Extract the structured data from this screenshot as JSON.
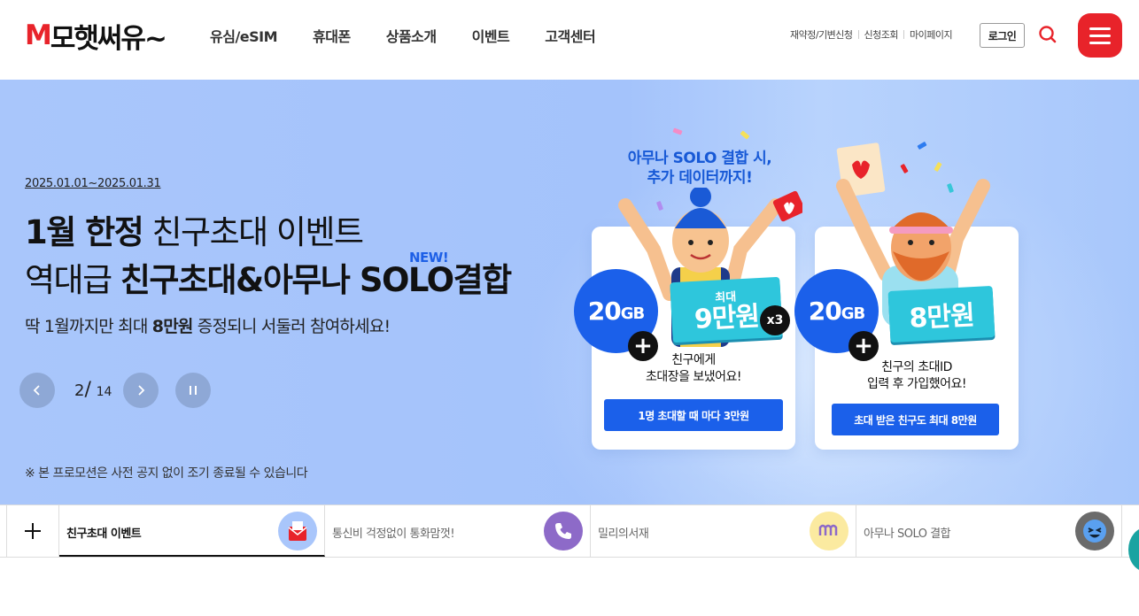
{
  "header": {
    "logo_m": "M",
    "logo_rest": "모햇써유~",
    "nav": [
      "유심/eSIM",
      "휴대폰",
      "상품소개",
      "이벤트",
      "고객센터"
    ],
    "util_links": [
      "재약정/기변신청",
      "신청조회",
      "마이페이지"
    ],
    "login_label": "로그인"
  },
  "hero": {
    "period": "2025.01.01~2025.01.31",
    "title_line1_bold": "1월 한정",
    "title_line1_rest": " 친구초대 이벤트",
    "title_line2_pre": "역대급 ",
    "title_line2_bold": "친구초대&아무나 SOLO결합",
    "new_badge": "NEW!",
    "sub_pre": "딱 1월까지만 최대 ",
    "sub_bold": "8만원",
    "sub_post": " 증정되니 서둘러 참여하세요!",
    "page_current": "2",
    "page_sep": "/",
    "page_total": "14",
    "notice": "※ 본 프로모션은 사전 공지 없이 조기 종료될 수 있습니다"
  },
  "promo": {
    "head_line1": "아무나 SOLO 결합 시,",
    "head_line2": "추가 데이터까지!",
    "left": {
      "gb_num": "20",
      "gb_unit": "GB",
      "ticket_small": "최대",
      "ticket_big": "9만원",
      "text_line1": "친구에게",
      "text_line2": "초대장을 보냈어요!",
      "button": "1명 초대할 때 마다 3만원",
      "multiplier": "x3"
    },
    "right": {
      "gb_num": "20",
      "gb_unit": "GB",
      "ticket_big": "8만원",
      "text_line1": "친구의 초대ID",
      "text_line2": "입력 후 가입했어요!",
      "button": "초대 받은 친구도 최대 8만원"
    }
  },
  "tabs": [
    {
      "label": "친구초대 이벤트",
      "active": true
    },
    {
      "label": "통신비 걱정없이 통화맘껏!",
      "active": false
    },
    {
      "label": "밀리의서재",
      "active": false
    },
    {
      "label": "아무나 SOLO 결합",
      "active": false
    }
  ],
  "colors": {
    "brand_red": "#e8232a",
    "hero_bg": "#a9c6fb",
    "accent_blue": "#1b60ea",
    "ticket_cyan": "#2ec6dc"
  }
}
